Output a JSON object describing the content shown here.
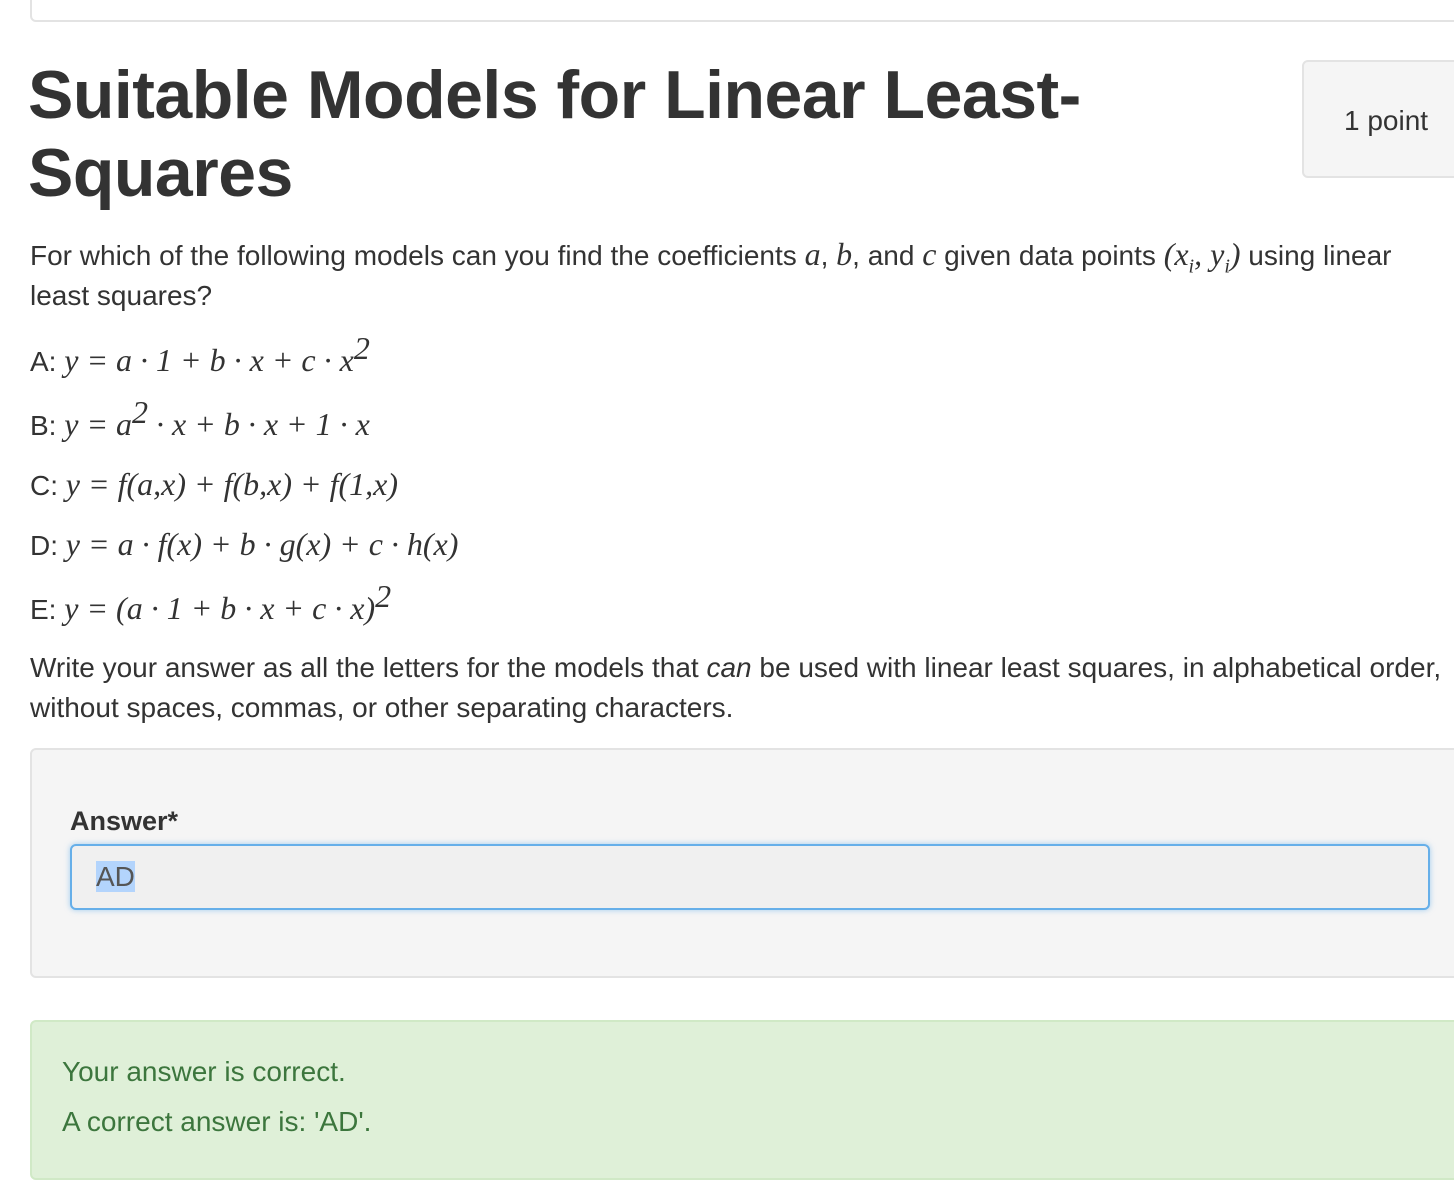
{
  "question": {
    "title": "Suitable Models for Linear Least-Squares",
    "points": "1 point",
    "prompt_part1": "For which of the following models can you find the coefficients ",
    "prompt_sym_a": "a",
    "prompt_sym_b": "b",
    "prompt_and": ", and ",
    "prompt_sym_c": "c",
    "prompt_part2": " given data points ",
    "prompt_points": "(x",
    "prompt_sub_i": "i",
    "prompt_points_mid": ", y",
    "prompt_points_end": ")",
    "prompt_part3": " using linear least squares?",
    "options": [
      {
        "label": "A: ",
        "formula": "y = a · 1 + b · x + c · x",
        "sup": "2",
        "tail": ""
      },
      {
        "label": "B: ",
        "formula": "y = a",
        "sup": "2",
        "tail": " · x + b · x + 1 · x"
      },
      {
        "label": "C: ",
        "formula": "y = f(a,x) + f(b,x) + f(1,x)",
        "sup": "",
        "tail": ""
      },
      {
        "label": "D: ",
        "formula": "y = a · f(x) + b · g(x) + c · h(x)",
        "sup": "",
        "tail": ""
      },
      {
        "label": "E: ",
        "formula": "y = (a · 1 + b · x + c · x)",
        "sup": "2",
        "tail": ""
      }
    ],
    "instructions_part1": "Write your answer as all the letters for the models that ",
    "instructions_emph": "can",
    "instructions_part2": " be used with linear least squares, in alphabetical order, without spaces, commas, or other separating characters."
  },
  "answer": {
    "label": "Answer*",
    "value": "AD"
  },
  "feedback": {
    "status": "Your answer is correct.",
    "correct_answer": "A correct answer is: 'AD'."
  }
}
